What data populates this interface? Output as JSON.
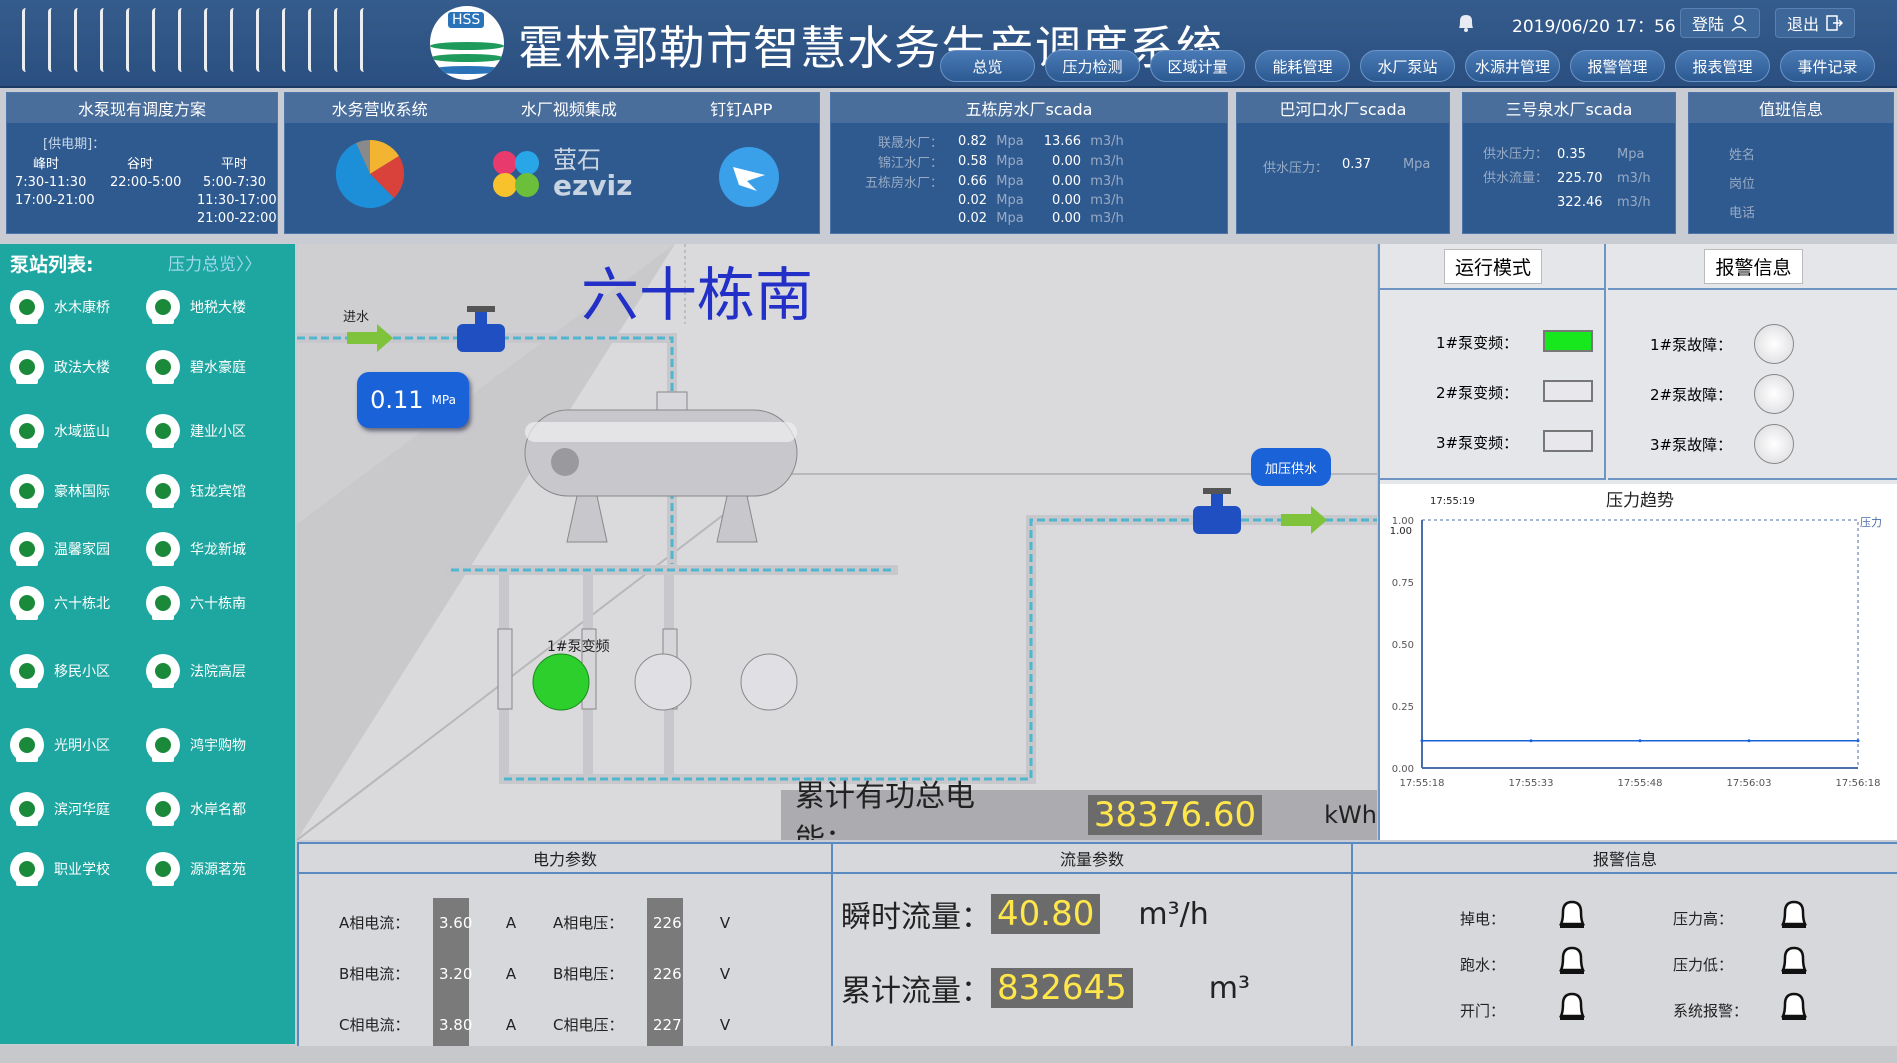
{
  "header": {
    "title": "霍林郭勒市智慧水务生产调度系统",
    "logo_text": "HSS",
    "datetime": "2019/06/20  17：56",
    "login_label": "登陆",
    "logout_label": "退出"
  },
  "nav": [
    "总览",
    "压力检测",
    "区域计量",
    "能耗管理",
    "水厂泵站",
    "水源井管理",
    "报警管理",
    "报表管理",
    "事件记录"
  ],
  "panels": {
    "schedule": {
      "title": "水泵现有调度方案",
      "period_label": "[供电期]：",
      "cols": [
        "峰时",
        "谷时",
        "平时"
      ],
      "peak": [
        "7:30-11:30",
        "17:00-21:00"
      ],
      "valley": [
        "22:00-5:00"
      ],
      "flat": [
        "5:00-7:30",
        "11:30-17:00",
        "21:00-22:00"
      ]
    },
    "billing": {
      "title": "水务营收系统"
    },
    "video": {
      "title": "水厂视频集成",
      "brand_cn": "萤石",
      "brand_en": "ezviz"
    },
    "dingding": {
      "title": "钉钉APP"
    },
    "wudong": {
      "title": "五栋房水厂scada",
      "rows": [
        {
          "name": "联晟水厂：",
          "p": "0.82",
          "pu": "Mpa",
          "f": "13.66",
          "fu": "m3/h"
        },
        {
          "name": "锦江水厂：",
          "p": "0.58",
          "pu": "Mpa",
          "f": "0.00",
          "fu": "m3/h"
        },
        {
          "name": "五栋房水厂：",
          "p": "0.66",
          "pu": "Mpa",
          "f": "0.00",
          "fu": "m3/h"
        },
        {
          "name": "",
          "p": "0.02",
          "pu": "Mpa",
          "f": "0.00",
          "fu": "m3/h"
        },
        {
          "name": "",
          "p": "0.02",
          "pu": "Mpa",
          "f": "0.00",
          "fu": "m3/h"
        }
      ]
    },
    "bahekou": {
      "title": "巴河口水厂scada",
      "label": "供水压力：",
      "value": "0.37",
      "unit": "Mpa"
    },
    "sanhao": {
      "title": "三号泉水厂scada",
      "pressure_label": "供水压力：",
      "pressure": "0.35",
      "pressure_unit": "Mpa",
      "flow_label": "供水流量：",
      "flow": "225.70",
      "flow_unit": "m3/h",
      "total": "322.46",
      "total_unit": "m3/h"
    },
    "duty": {
      "title": "值班信息",
      "name": "姓名",
      "post": "岗位",
      "phone": "电话"
    }
  },
  "sidebar": {
    "title": "泵站列表:",
    "link": "压力总览〉〉",
    "left": [
      "水木康桥",
      "政法大楼",
      "水域蓝山",
      "豪林国际",
      "温馨家园",
      "六十栋北",
      "移民小区",
      "光明小区",
      "滨河华庭",
      "职业学校"
    ],
    "right": [
      "地税大楼",
      "碧水豪庭",
      "建业小区",
      "钰龙宾馆",
      "华龙新城",
      "六十栋南",
      "法院高层",
      "鸿宇购物",
      "水岸名都",
      "源源茗苑"
    ]
  },
  "main": {
    "station_name": "六十栋南",
    "inlet_label": "进水",
    "pressure_value": "0.11",
    "pressure_unit": "MPa",
    "boost_label": "加压供水",
    "pump1_label": "1#泵变频",
    "energy_label": "累计有功总电能：",
    "energy_value": "38376.60",
    "energy_unit": "kWh"
  },
  "run_mode": {
    "title": "运行模式",
    "items": [
      {
        "label": "1#泵变频：",
        "on": true
      },
      {
        "label": "2#泵变频：",
        "on": false
      },
      {
        "label": "3#泵变频：",
        "on": false
      }
    ]
  },
  "alarm_top": {
    "title": "报警信息",
    "items": [
      "1#泵故障：",
      "2#泵故障：",
      "3#泵故障："
    ]
  },
  "trend": {
    "title": "压力趋势",
    "cursor_time": "17:55:19",
    "legend": "压力",
    "cursor_value": "1.00",
    "y_ticks": [
      "1.00",
      "0.75",
      "0.50",
      "0.25",
      "0.00"
    ],
    "x_ticks": [
      "17:55:18",
      "17:55:33",
      "17:55:48",
      "17:56:03",
      "17:56:18"
    ]
  },
  "chart_data": {
    "type": "line",
    "title": "压力趋势",
    "xlabel": "",
    "ylabel": "",
    "ylim": [
      0,
      1.0
    ],
    "x": [
      "17:55:18",
      "17:55:33",
      "17:55:48",
      "17:56:03",
      "17:56:18"
    ],
    "series": [
      {
        "name": "压力",
        "values": [
          0.11,
          0.11,
          0.11,
          0.11,
          0.11
        ]
      }
    ]
  },
  "power": {
    "title": "电力参数",
    "rows": [
      {
        "cl": "A相电流：",
        "cv": "3.60",
        "cu": "A",
        "vl": "A相电压：",
        "vv": "226",
        "vu": "V"
      },
      {
        "cl": "B相电流：",
        "cv": "3.20",
        "cu": "A",
        "vl": "B相电压：",
        "vv": "226",
        "vu": "V"
      },
      {
        "cl": "C相电流：",
        "cv": "3.80",
        "cu": "A",
        "vl": "C相电压：",
        "vv": "227",
        "vu": "V"
      }
    ]
  },
  "flow": {
    "title": "流量参数",
    "inst_label": "瞬时流量：",
    "inst_value": "40.80",
    "inst_unit": "m³/h",
    "total_label": "累计流量：",
    "total_value": "832645",
    "total_unit": "m³"
  },
  "alarm_bottom": {
    "title": "报警信息",
    "left": [
      "掉电：",
      "跑水：",
      "开门："
    ],
    "right": [
      "压力高：",
      "压力低：",
      "系统报警："
    ]
  },
  "colors": {
    "accent": "#2a4f80",
    "sidebar": "#1ea6a0",
    "pipe": "#5ab8d0",
    "pump_on": "#2ccf2c",
    "value_yellow": "#ffe64a"
  }
}
